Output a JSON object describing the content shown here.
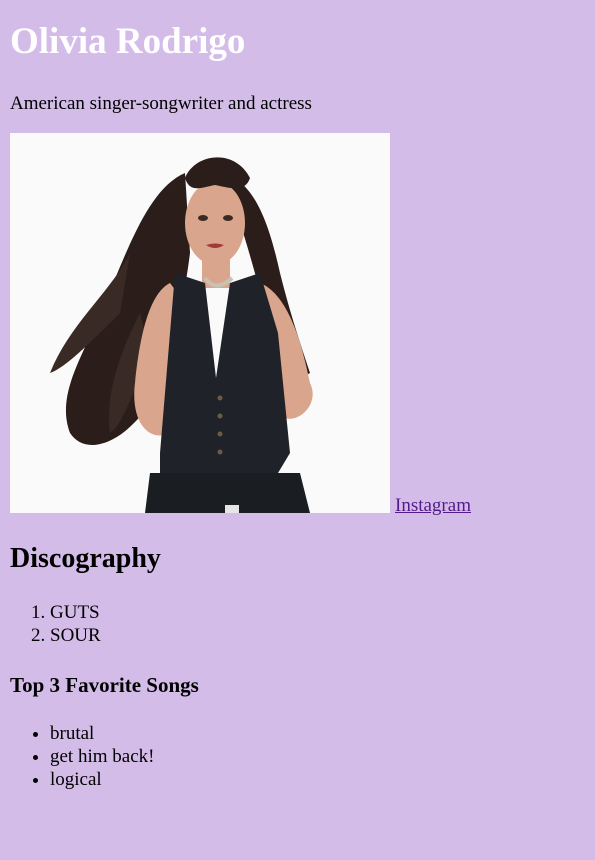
{
  "header": {
    "title": "Olivia Rodrigo",
    "tagline": "American singer-songwriter and actress"
  },
  "photo": {
    "alt": "Olivia Rodrigo portrait"
  },
  "links": {
    "instagram_label": "Instagram"
  },
  "discography": {
    "heading": "Discography",
    "albums": [
      "GUTS",
      "SOUR"
    ]
  },
  "favorites": {
    "heading": "Top 3 Favorite Songs",
    "songs": [
      "brutal",
      "get him back!",
      "logical"
    ]
  }
}
